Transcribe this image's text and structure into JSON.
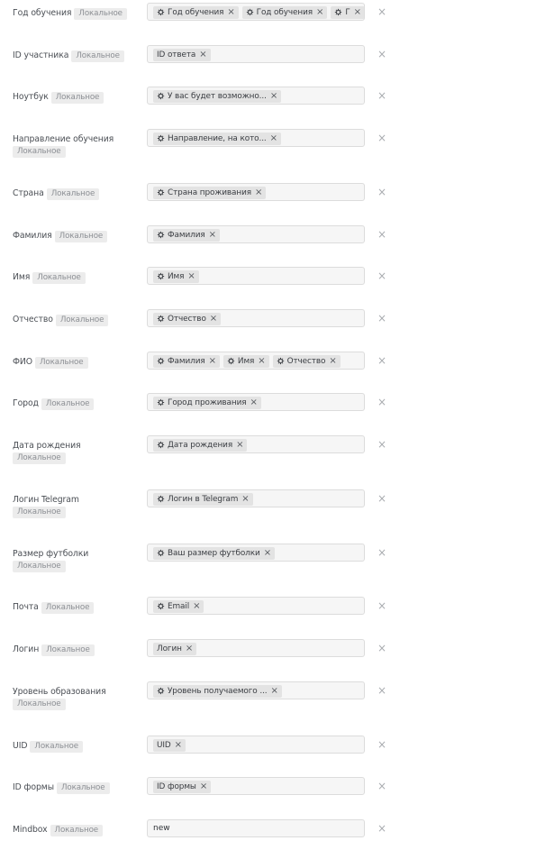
{
  "rows": [
    {
      "label": "Год обучения",
      "badge": "Локальное",
      "chips": [
        {
          "text": "Год обучения",
          "gear": true
        },
        {
          "text": "Год обучения",
          "gear": true
        },
        {
          "text": "Г",
          "gear": true
        }
      ]
    },
    {
      "label": "ID участника",
      "badge": "Локальное",
      "chips": [
        {
          "text": "ID ответа",
          "gear": false
        }
      ]
    },
    {
      "label": "Ноутбук",
      "badge": "Локальное",
      "chips": [
        {
          "text": "У вас будет возможно...",
          "gear": true
        }
      ]
    },
    {
      "label": "Направление обучения",
      "badge": "Локальное",
      "chips": [
        {
          "text": "Направление, на кото...",
          "gear": true
        }
      ]
    },
    {
      "label": "Страна",
      "badge": "Локальное",
      "chips": [
        {
          "text": "Страна проживания",
          "gear": true
        }
      ]
    },
    {
      "label": "Фамилия",
      "badge": "Локальное",
      "chips": [
        {
          "text": "Фамилия",
          "gear": true
        }
      ]
    },
    {
      "label": "Имя",
      "badge": "Локальное",
      "chips": [
        {
          "text": "Имя",
          "gear": true
        }
      ]
    },
    {
      "label": "Отчество",
      "badge": "Локальное",
      "chips": [
        {
          "text": "Отчество",
          "gear": true
        }
      ]
    },
    {
      "label": "ФИО",
      "badge": "Локальное",
      "chips": [
        {
          "text": "Фамилия",
          "gear": true
        },
        {
          "text": "Имя",
          "gear": true
        },
        {
          "text": "Отчество",
          "gear": true
        }
      ]
    },
    {
      "label": "Город",
      "badge": "Локальное",
      "chips": [
        {
          "text": "Город проживания",
          "gear": true
        }
      ]
    },
    {
      "label": "Дата рождения",
      "badge": "Локальное",
      "chips": [
        {
          "text": "Дата рождения",
          "gear": true
        }
      ]
    },
    {
      "label": "Логин Telegram",
      "badge": "Локальное",
      "chips": [
        {
          "text": "Логин в Telegram",
          "gear": true
        }
      ]
    },
    {
      "label": "Размер футболки",
      "badge": "Локальное",
      "chips": [
        {
          "text": "Ваш размер футболки",
          "gear": true
        }
      ]
    },
    {
      "label": "Почта",
      "badge": "Локальное",
      "chips": [
        {
          "text": "Email",
          "gear": true
        }
      ]
    },
    {
      "label": "Логин",
      "badge": "Локальное",
      "chips": [
        {
          "text": "Логин",
          "gear": false
        }
      ]
    },
    {
      "label": "Уровень образования",
      "badge": "Локальное",
      "chips": [
        {
          "text": "Уровень получаемого ...",
          "gear": true
        }
      ]
    },
    {
      "label": "UID",
      "badge": "Локальное",
      "chips": [
        {
          "text": "UID",
          "gear": false
        }
      ]
    },
    {
      "label": "ID формы",
      "badge": "Локальное",
      "chips": [
        {
          "text": "ID формы",
          "gear": false
        }
      ]
    },
    {
      "label": "Mindbox",
      "badge": "Локальное",
      "value": "new",
      "chips": []
    }
  ],
  "icons": {
    "chip_remove": "close-icon",
    "row_remove": "close-icon",
    "chip_param": "gear-icon"
  },
  "glyphs": {
    "close": "×"
  }
}
